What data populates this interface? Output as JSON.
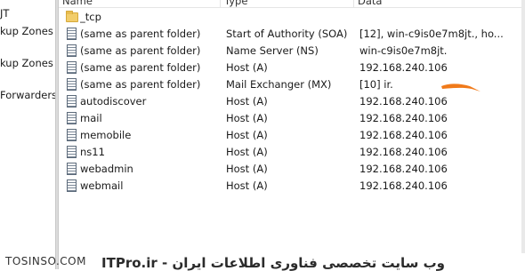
{
  "tree": {
    "items": [
      "JT",
      "kup Zones",
      "kup Zones",
      "Forwarders"
    ]
  },
  "columns": {
    "name": "Name",
    "type": "Type",
    "data": "Data"
  },
  "rows": [
    {
      "icon": "folder-icon",
      "name": "_tcp",
      "type": "",
      "data": ""
    },
    {
      "icon": "record-icon",
      "name": "(same as parent folder)",
      "type": "Start of Authority (SOA)",
      "data": "[12], win-c9is0e7m8jt., ho..."
    },
    {
      "icon": "record-icon",
      "name": "(same as parent folder)",
      "type": "Name Server (NS)",
      "data": "win-c9is0e7m8jt."
    },
    {
      "icon": "record-icon",
      "name": "(same as parent folder)",
      "type": "Host (A)",
      "data": "192.168.240.106"
    },
    {
      "icon": "record-icon",
      "name": "(same as parent folder)",
      "type": "Mail Exchanger (MX)",
      "data": "[10]         ir."
    },
    {
      "icon": "record-icon",
      "name": "autodiscover",
      "type": "Host (A)",
      "data": "192.168.240.106"
    },
    {
      "icon": "record-icon",
      "name": "mail",
      "type": "Host (A)",
      "data": "192.168.240.106"
    },
    {
      "icon": "record-icon",
      "name": "memobile",
      "type": "Host (A)",
      "data": "192.168.240.106"
    },
    {
      "icon": "record-icon",
      "name": "ns11",
      "type": "Host (A)",
      "data": "192.168.240.106"
    },
    {
      "icon": "record-icon",
      "name": "webadmin",
      "type": "Host (A)",
      "data": "192.168.240.106"
    },
    {
      "icon": "record-icon",
      "name": "webmail",
      "type": "Host (A)",
      "data": "192.168.240.106"
    }
  ],
  "footer": {
    "left_watermark": "TOSINSO.COM",
    "right_watermark": "ITPro.ir - وب سایت تخصصی فناوری اطلاعات ایران"
  },
  "colors": {
    "redaction": "#f07a1a"
  }
}
